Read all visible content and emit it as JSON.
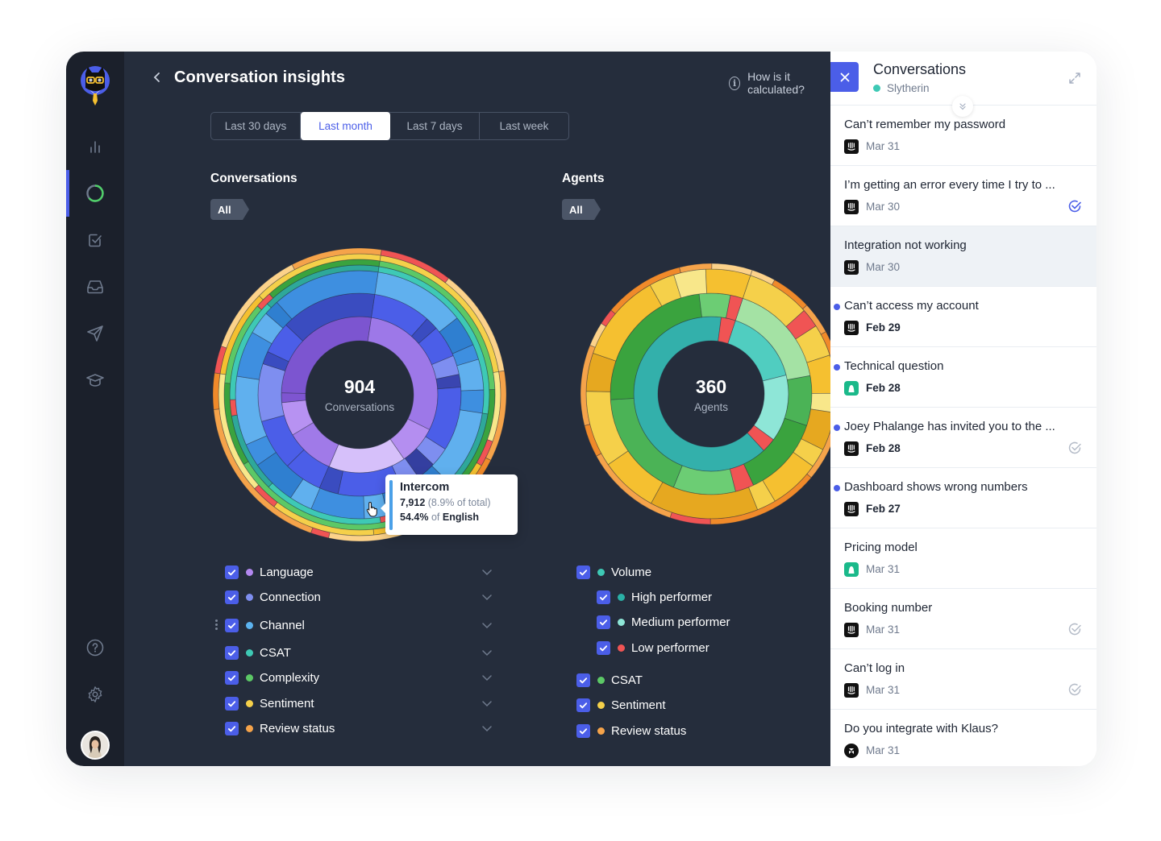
{
  "sidebar": {
    "logo": "klaus-cat-logo",
    "items": [
      {
        "name": "dashboard",
        "icon": "bar-chart-icon"
      },
      {
        "name": "insights",
        "icon": "ring-icon",
        "active": true
      },
      {
        "name": "tasks",
        "icon": "checkbox-icon"
      },
      {
        "name": "inbox",
        "icon": "inbox-icon"
      },
      {
        "name": "send",
        "icon": "send-icon"
      },
      {
        "name": "learning",
        "icon": "graduation-cap-icon"
      }
    ],
    "bottom": [
      {
        "name": "help",
        "icon": "help-icon"
      },
      {
        "name": "settings",
        "icon": "gear-icon"
      }
    ]
  },
  "header": {
    "back_icon": "chevron-left-icon",
    "title": "Conversation insights",
    "help_label": "How is it calculated?"
  },
  "tabs": [
    {
      "label": "Last 30 days",
      "active": false
    },
    {
      "label": "Last month",
      "active": true
    },
    {
      "label": "Last 7 days",
      "active": false
    },
    {
      "label": "Last week",
      "active": false
    }
  ],
  "conversations_section": {
    "title": "Conversations",
    "filter_chip": "All",
    "center_value": "904",
    "center_label": "Conversations",
    "tooltip": {
      "title": "Intercom",
      "count": "7,912",
      "share": "(8.9% of total)",
      "pct": "54.4%",
      "of_word": "of",
      "parent": "English"
    },
    "legend": [
      {
        "label": "Language",
        "color": "#b388f0"
      },
      {
        "label": "Connection",
        "color": "#7e8ef0"
      },
      {
        "label": "Channel",
        "color": "#5cb3f0"
      },
      {
        "label": "CSAT",
        "color": "#3ec9b5"
      },
      {
        "label": "Complexity",
        "color": "#5cc866"
      },
      {
        "label": "Sentiment",
        "color": "#f5d04a"
      },
      {
        "label": "Review status",
        "color": "#f5a34a"
      }
    ]
  },
  "agents_section": {
    "title": "Agents",
    "filter_chip": "All",
    "center_value": "360",
    "center_label": "Agents",
    "legend": [
      {
        "label": "Volume",
        "color": "#3ec9b5",
        "level": 0,
        "chevron": true
      },
      {
        "label": "High performer",
        "color": "#2ab0a6",
        "level": 1,
        "chevron": false
      },
      {
        "label": "Medium performer",
        "color": "#8ee6d7",
        "level": 1,
        "chevron": false
      },
      {
        "label": "Low performer",
        "color": "#f05454",
        "level": 1,
        "chevron": false
      },
      {
        "label": "CSAT",
        "color": "#5cc866",
        "level": 0,
        "chevron": true
      },
      {
        "label": "Sentiment",
        "color": "#f5d04a",
        "level": 0,
        "chevron": true
      },
      {
        "label": "Review status",
        "color": "#f5a34a",
        "level": 0,
        "chevron": true
      }
    ]
  },
  "chart_data": [
    {
      "type": "sunburst",
      "title": "Conversations",
      "total": 904,
      "rings": [
        {
          "name": "Language",
          "segments": [
            [
              0.3,
              "#9d78e8"
            ],
            [
              0.08,
              "#b48ef0"
            ],
            [
              0.16,
              "#d6c0fa"
            ],
            [
              0.1,
              "#a07ae8"
            ],
            [
              0.07,
              "#b792f2"
            ],
            [
              0.02,
              "#7e55d0"
            ],
            [
              0.27,
              "#7c55d0"
            ]
          ]
        },
        {
          "name": "Connection",
          "segments": [
            [
              0.09,
              "#4b5ee8"
            ],
            [
              0.02,
              "#3a4cc0"
            ],
            [
              0.05,
              "#4b5ee8"
            ],
            [
              0.03,
              "#7e8ef0"
            ],
            [
              0.02,
              "#3a45b0"
            ],
            [
              0.1,
              "#4b5ee8"
            ],
            [
              0.03,
              "#7e8ef0"
            ],
            [
              0.03,
              "#343fa0"
            ],
            [
              0.03,
              "#7e8ef0"
            ],
            [
              0.1,
              "#4b5ee8"
            ],
            [
              0.03,
              "#3a4cc0"
            ],
            [
              0.06,
              "#4b5ee8"
            ],
            [
              0.08,
              "#4b5ee8"
            ],
            [
              0.09,
              "#7e8ef0"
            ],
            [
              0.02,
              "#3a4cc0"
            ],
            [
              0.05,
              "#4b5ee8"
            ],
            [
              0.15,
              "#3a4cc0"
            ]
          ]
        },
        {
          "name": "Channel",
          "segments": [
            [
              0.12,
              "#60b0ee"
            ],
            [
              0.04,
              "#2f7fd0"
            ],
            [
              0.02,
              "#3e8fe0"
            ],
            [
              0.04,
              "#60b0ee"
            ],
            [
              0.03,
              "#3e8fe0"
            ],
            [
              0.1,
              "#60b0ee"
            ],
            [
              0.02,
              "#2f7fd0"
            ],
            [
              0.04,
              "#60b0ee"
            ],
            [
              0.03,
              "#2f7fd0"
            ],
            [
              0.03,
              "#60b0ee"
            ],
            [
              0.07,
              "#3e8fe0"
            ],
            [
              0.03,
              "#60b0ee"
            ],
            [
              0.06,
              "#2f7fd0"
            ],
            [
              0.03,
              "#3e8fe0"
            ],
            [
              0.09,
              "#60b0ee"
            ],
            [
              0.06,
              "#3e8fe0"
            ],
            [
              0.03,
              "#60b0ee"
            ],
            [
              0.02,
              "#2f7fd0"
            ],
            [
              0.14,
              "#3e8fe0"
            ]
          ]
        },
        {
          "name": "CSAT",
          "segments": [
            [
              0.25,
              "#3ec9b5"
            ],
            [
              0.1,
              "#2ea89a"
            ],
            [
              0.08,
              "#8ee6d7"
            ],
            [
              0.02,
              "#f05454"
            ],
            [
              0.15,
              "#3ec9b5"
            ],
            [
              0.1,
              "#2ea89a"
            ],
            [
              0.02,
              "#f05454"
            ],
            [
              0.13,
              "#3ec9b5"
            ],
            [
              0.15,
              "#2ea89a"
            ]
          ]
        },
        {
          "name": "Complexity",
          "segments": [
            [
              0.22,
              "#5cc866"
            ],
            [
              0.12,
              "#3aa33e"
            ],
            [
              0.08,
              "#a4e2a4"
            ],
            [
              0.02,
              "#f05454"
            ],
            [
              0.2,
              "#5cc866"
            ],
            [
              0.1,
              "#3aa33e"
            ],
            [
              0.1,
              "#5cc866"
            ],
            [
              0.02,
              "#f05454"
            ],
            [
              0.14,
              "#3aa33e"
            ]
          ]
        },
        {
          "name": "Sentiment",
          "segments": [
            [
              0.2,
              "#f5d04a"
            ],
            [
              0.08,
              "#f8e78a"
            ],
            [
              0.03,
              "#f05454"
            ],
            [
              0.15,
              "#f5c030"
            ],
            [
              0.12,
              "#f5d04a"
            ],
            [
              0.03,
              "#f05454"
            ],
            [
              0.14,
              "#f8e78a"
            ],
            [
              0.1,
              "#f5c030"
            ],
            [
              0.15,
              "#f5d04a"
            ]
          ]
        },
        {
          "name": "Review status",
          "segments": [
            [
              0.08,
              "#f05454"
            ],
            [
              0.12,
              "#fcd28a"
            ],
            [
              0.1,
              "#f5a34a"
            ],
            [
              0.06,
              "#f08a2a"
            ],
            [
              0.15,
              "#fcd28a"
            ],
            [
              0.02,
              "#f05454"
            ],
            [
              0.18,
              "#f5a34a"
            ],
            [
              0.04,
              "#f08a2a"
            ],
            [
              0.03,
              "#f05454"
            ],
            [
              0.12,
              "#fcd28a"
            ],
            [
              0.1,
              "#f5a34a"
            ]
          ]
        }
      ]
    },
    {
      "type": "sunburst",
      "title": "Agents",
      "total": 360,
      "rings": [
        {
          "name": "Volume",
          "segments": [
            [
              0.16,
              "#50cdc0"
            ],
            [
              0.14,
              "#8ee6d7"
            ],
            [
              0.03,
              "#f05454"
            ],
            [
              0.64,
              "#33b0ab"
            ],
            [
              0.03,
              "#f05454"
            ]
          ]
        },
        {
          "name": "CSAT",
          "segments": [
            [
              0.17,
              "#a4e2a4"
            ],
            [
              0.08,
              "#4bb356"
            ],
            [
              0.13,
              "#3aa33e"
            ],
            [
              0.03,
              "#f05454"
            ],
            [
              0.1,
              "#6ccd74"
            ],
            [
              0.18,
              "#4bb356"
            ],
            [
              0.24,
              "#3aa33e"
            ],
            [
              0.05,
              "#6ccd74"
            ],
            [
              0.02,
              "#f05454"
            ]
          ]
        },
        {
          "name": "Sentiment",
          "segments": [
            [
              0.1,
              "#f5d04a"
            ],
            [
              0.03,
              "#f05454"
            ],
            [
              0.05,
              "#f5d04a"
            ],
            [
              0.06,
              "#f5c030"
            ],
            [
              0.03,
              "#f8e78a"
            ],
            [
              0.06,
              "#e6a820"
            ],
            [
              0.03,
              "#f5d04a"
            ],
            [
              0.08,
              "#f5c030"
            ],
            [
              0.03,
              "#f5d04a"
            ],
            [
              0.17,
              "#e6a820"
            ],
            [
              0.09,
              "#f5c030"
            ],
            [
              0.12,
              "#f5d04a"
            ],
            [
              0.06,
              "#e6a820"
            ],
            [
              0.14,
              "#f5c030"
            ],
            [
              0.04,
              "#f5d04a"
            ],
            [
              0.05,
              "#f8e78a"
            ],
            [
              0.07,
              "#f5c030"
            ]
          ]
        },
        {
          "name": "Review status",
          "segments": [
            [
              0.03,
              "#fcd28a"
            ],
            [
              0.05,
              "#f08a2a"
            ],
            [
              0.04,
              "#f5a34a"
            ],
            [
              0.1,
              "#f08a2a"
            ],
            [
              0.03,
              "#fcd28a"
            ],
            [
              0.06,
              "#f5a34a"
            ],
            [
              0.14,
              "#f08a2a"
            ],
            [
              0.05,
              "#f05454"
            ],
            [
              0.12,
              "#f5a34a"
            ],
            [
              0.04,
              "#f08a2a"
            ],
            [
              0.1,
              "#f5a34a"
            ],
            [
              0.03,
              "#fcd28a"
            ],
            [
              0.02,
              "#f05454"
            ],
            [
              0.1,
              "#f08a2a"
            ],
            [
              0.04,
              "#f5a34a"
            ],
            [
              0.05,
              "#fcd28a"
            ]
          ]
        }
      ]
    }
  ],
  "panel": {
    "title": "Conversations",
    "subtitle": "Slytherin",
    "subtitle_color": "#3ec9b5",
    "items": [
      {
        "title": "Can’t remember my password",
        "date": "Mar 31",
        "source": "intercom",
        "unread": false,
        "status": "none",
        "selected": false
      },
      {
        "title": "I’m getting an error every time I try to ...",
        "date": "Mar 30",
        "source": "intercom",
        "unread": false,
        "status": "reviewed-active",
        "selected": false
      },
      {
        "title": "Integration not working",
        "date": "Mar 30",
        "source": "intercom",
        "unread": false,
        "status": "none",
        "selected": true
      },
      {
        "title": "Can’t access my account",
        "date": "Feb 29",
        "source": "intercom",
        "unread": true,
        "status": "none",
        "selected": false
      },
      {
        "title": "Technical question",
        "date": "Feb 28",
        "source": "aircall",
        "unread": true,
        "status": "none",
        "selected": false
      },
      {
        "title": "Joey Phalange has invited you to the ...",
        "date": "Feb 28",
        "source": "intercom",
        "unread": true,
        "status": "reviewed",
        "selected": false
      },
      {
        "title": "Dashboard shows wrong numbers",
        "date": "Feb 27",
        "source": "intercom",
        "unread": true,
        "status": "none",
        "selected": false
      },
      {
        "title": "Pricing model",
        "date": "Mar 31",
        "source": "aircall",
        "unread": false,
        "status": "none",
        "selected": false
      },
      {
        "title": "Booking number",
        "date": "Mar 31",
        "source": "intercom",
        "unread": false,
        "status": "reviewed",
        "selected": false
      },
      {
        "title": "Can’t log in",
        "date": "Mar 31",
        "source": "intercom",
        "unread": false,
        "status": "reviewed",
        "selected": false
      },
      {
        "title": "Do you integrate with Klaus?",
        "date": "Mar 31",
        "source": "zendesk",
        "unread": false,
        "status": "none",
        "selected": false
      }
    ]
  }
}
